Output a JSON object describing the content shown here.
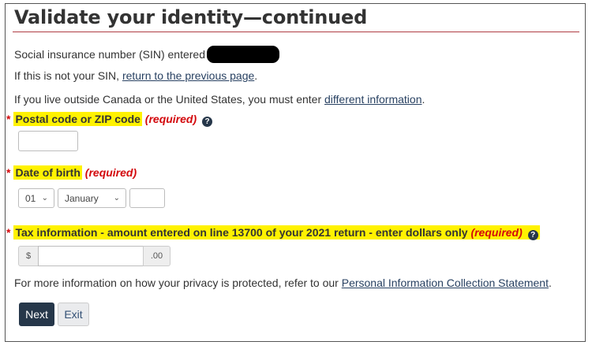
{
  "page": {
    "title": "Validate your identity—continued",
    "sin_label": "Social insurance number (SIN) entered",
    "not_sin_prefix": "If this is not your SIN, ",
    "not_sin_link": "return to the previous page",
    "not_sin_suffix": ".",
    "outside_prefix": "If you live outside Canada or the United States, you must enter ",
    "outside_link": "different information",
    "outside_suffix": "."
  },
  "fields": {
    "postal": {
      "star": "*",
      "label": "Postal code or ZIP code",
      "required": "(required)",
      "help": "?"
    },
    "dob": {
      "star": "*",
      "label": "Date of birth",
      "required": "(required)",
      "day": "01",
      "month": "January",
      "year": ""
    },
    "tax": {
      "star": "*",
      "label": "Tax information - amount entered on line 13700 of your 2021 return - enter dollars only",
      "required": "(required)",
      "help": "?",
      "prefix": "$",
      "suffix": ".00"
    }
  },
  "privacy": {
    "prefix": "For more information on how your privacy is protected, refer to our ",
    "link": "Personal Information Collection Statement",
    "suffix": "."
  },
  "buttons": {
    "next": "Next",
    "exit": "Exit"
  },
  "colors": {
    "highlight": "#fff200",
    "required_red": "#d3080c",
    "primary_button": "#26374a",
    "title_rule": "#af3c43"
  }
}
